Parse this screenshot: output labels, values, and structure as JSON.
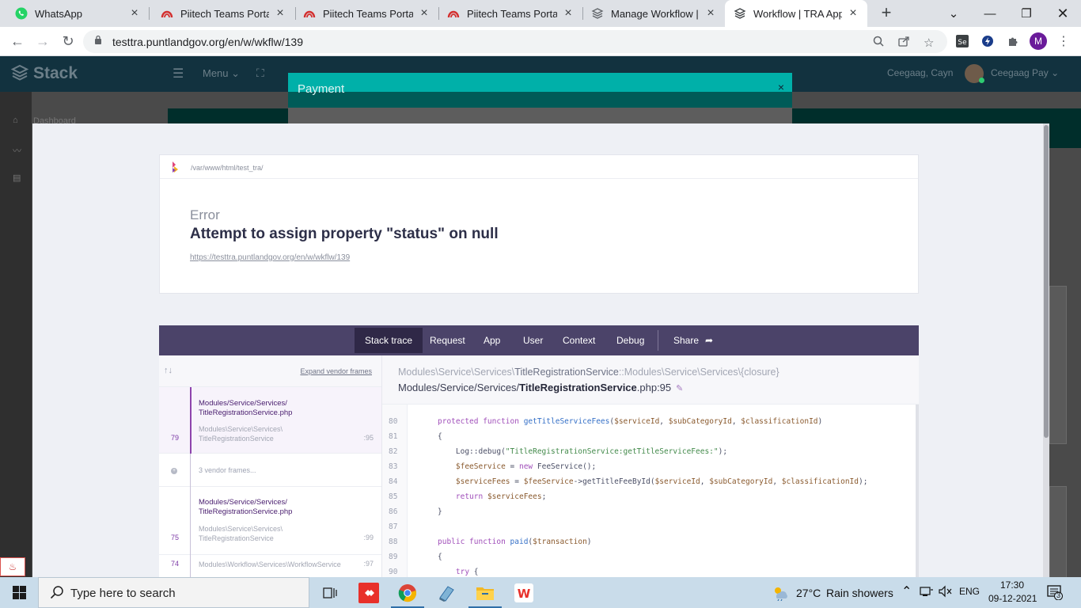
{
  "browser": {
    "tabs": [
      {
        "title": "WhatsApp",
        "icon": "whatsapp-icon",
        "color": "#25d366"
      },
      {
        "title": "Piitech Teams Portal",
        "icon": "piitech-icon",
        "color": "#d32f2f"
      },
      {
        "title": "Piitech Teams Portal",
        "icon": "piitech-icon",
        "color": "#d32f2f"
      },
      {
        "title": "Piitech Teams Portal",
        "icon": "piitech-icon",
        "color": "#d32f2f"
      },
      {
        "title": "Manage Workflow | TRA App",
        "icon": "stack-icon",
        "color": "#5f6368"
      },
      {
        "title": "Workflow | TRA App",
        "icon": "stack-icon",
        "color": "#5f6368"
      }
    ],
    "url": "testtra.puntlandgov.org/en/w/wkflw/139",
    "profile_initial": "M"
  },
  "app": {
    "brand": "Stack",
    "menu_label": "Menu",
    "user_name": "Ceegaag, Cayn",
    "user_short": "Ceegaag Pay",
    "sidebar_dashboard": "Dashboard"
  },
  "payment_modal": {
    "title": "Payment",
    "close": "×"
  },
  "error": {
    "path": "/var/www/html/test_tra/",
    "class": "Error",
    "message": "Attempt to assign property \"status\" on null",
    "url": "https://testtra.puntlandgov.org/en/w/wkflw/139"
  },
  "trace_nav": {
    "tabs": [
      "Stack trace",
      "Request",
      "App",
      "User",
      "Context",
      "Debug"
    ],
    "share": "Share"
  },
  "frames": {
    "expand_label": "Expand vendor frames",
    "items": [
      {
        "path": "Modules/Service/Services/ TitleRegistrationService.php",
        "cls": "Modules\\Service\\Services\\ TitleRegistrationService",
        "line": "79",
        "col": ":95"
      },
      {
        "vendor": "3 vendor frames..."
      },
      {
        "path": "Modules/Service/Services/ TitleRegistrationService.php",
        "cls": "Modules\\Service\\Services\\ TitleRegistrationService",
        "line": "75",
        "col": ":99"
      },
      {
        "path": "",
        "cls": "Modules\\Workflow\\Services\\WorkflowService",
        "line": "74",
        "col": ":97"
      }
    ]
  },
  "code": {
    "header_ns": "Modules\\Service\\Services\\",
    "header_class": "TitleRegistrationService",
    "header_rest": "::Modules\\Service\\Services\\{closure}",
    "file_prefix": "Modules/Service/Services/",
    "file_name": "TitleRegistrationService",
    "file_suffix": ".php:95",
    "lines": [
      {
        "n": "80",
        "html": "<span class=\"kw\">protected function</span> <span class=\"fn\">getTitleServiceFees</span>(<span class=\"var\">$serviceId</span>, <span class=\"var\">$subCategoryId</span>, <span class=\"var\">$classificationId</span>)"
      },
      {
        "n": "81",
        "html": "{"
      },
      {
        "n": "82",
        "html": "    Log::debug(<span class=\"str\">\"TitleRegistrationService:getTitleServiceFees:\"</span>);"
      },
      {
        "n": "83",
        "html": "    <span class=\"var\">$feeService</span> = <span class=\"kw\">new</span> FeeService();"
      },
      {
        "n": "84",
        "html": "    <span class=\"var\">$serviceFees</span> = <span class=\"var\">$feeService</span>->getTitleFeeById(<span class=\"var\">$serviceId</span>, <span class=\"var\">$subCategoryId</span>, <span class=\"var\">$classificationId</span>);"
      },
      {
        "n": "85",
        "html": "    <span class=\"kw\">return</span> <span class=\"var\">$serviceFees</span>;"
      },
      {
        "n": "86",
        "html": "}"
      },
      {
        "n": "87",
        "html": ""
      },
      {
        "n": "88",
        "html": "<span class=\"kw\">public function</span> <span class=\"fn\">paid</span>(<span class=\"var\">$transaction</span>)"
      },
      {
        "n": "89",
        "html": "{"
      },
      {
        "n": "90",
        "html": "    <span class=\"kw\">try</span> {"
      }
    ]
  },
  "taskbar": {
    "search_placeholder": "Type here to search",
    "weather_temp": "27°C",
    "weather_text": "Rain showers",
    "lang": "ENG",
    "time": "17:30",
    "date": "09-12-2021",
    "notifications": "3"
  }
}
